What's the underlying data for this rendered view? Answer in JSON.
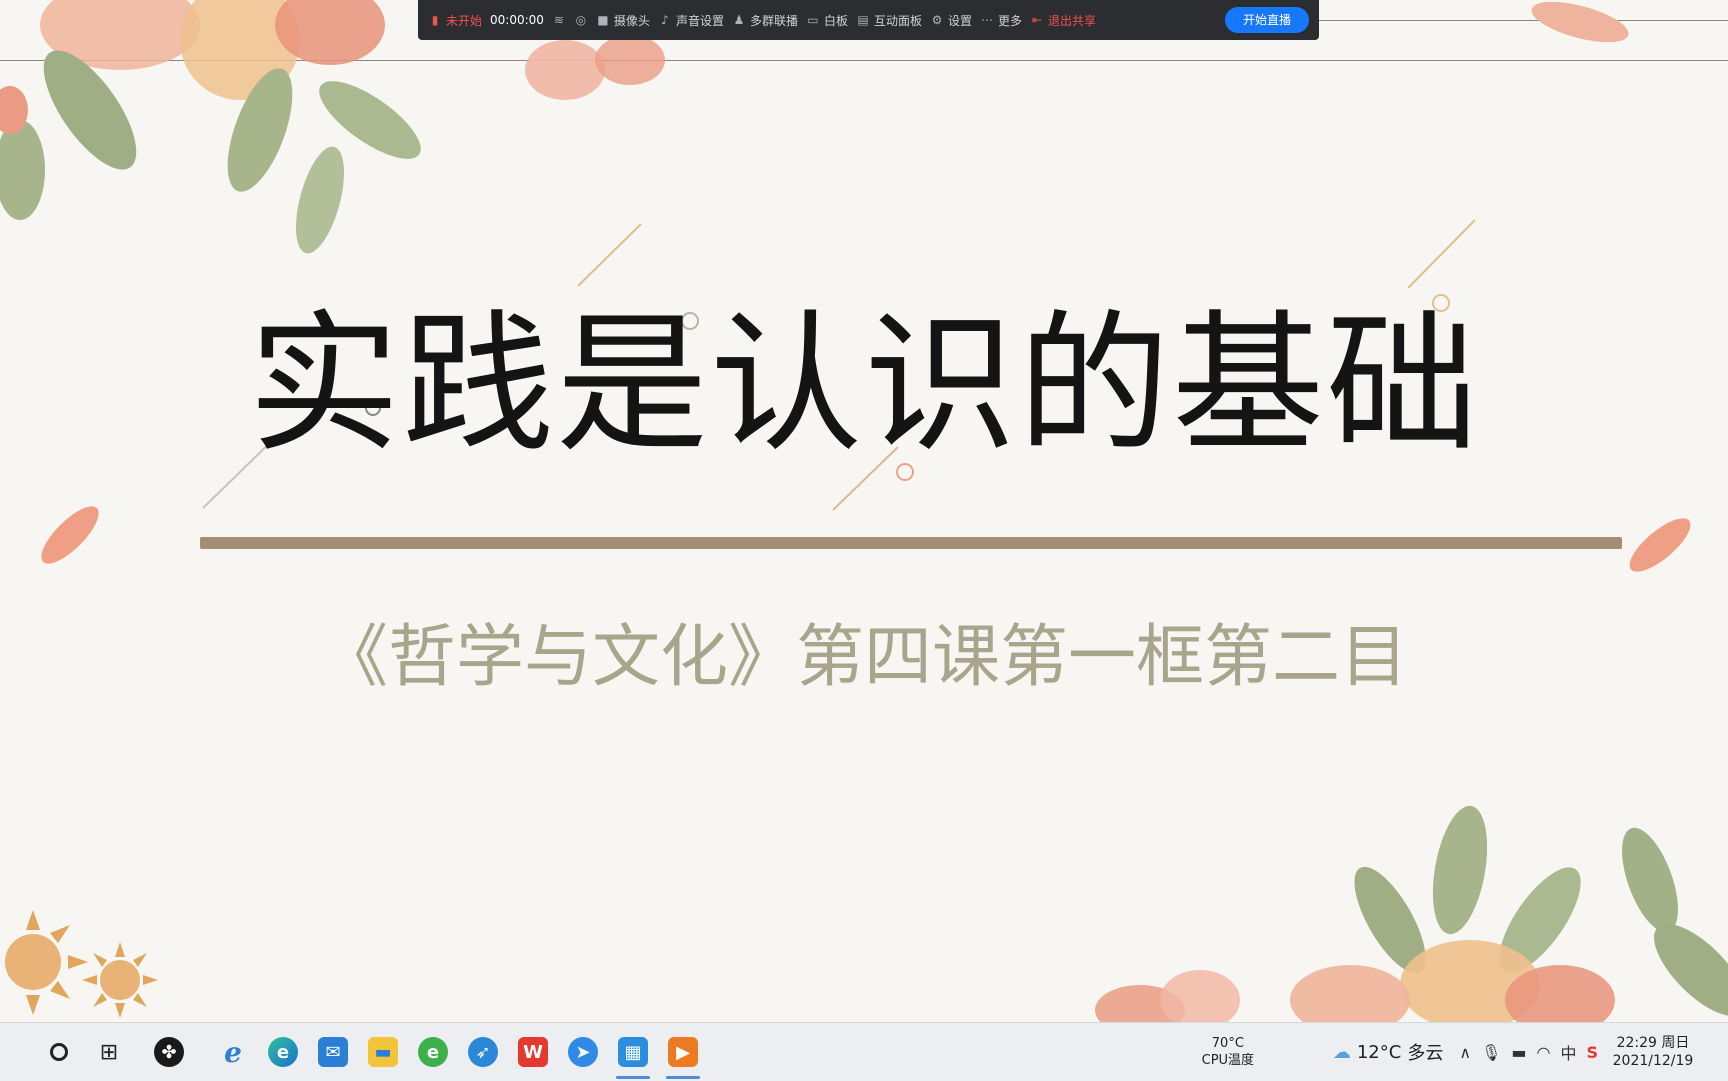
{
  "toolbar": {
    "status_label": "未开始",
    "timer": "00:00:00",
    "items": [
      {
        "label": "摄像头"
      },
      {
        "label": "声音设置"
      },
      {
        "label": "多群联播"
      },
      {
        "label": "白板"
      },
      {
        "label": "互动面板"
      },
      {
        "label": "设置"
      },
      {
        "label": "更多"
      }
    ],
    "exit_label": "退出共享",
    "start_label": "开始直播"
  },
  "slide": {
    "title": "实践是认识的基础",
    "subtitle": "《哲学与文化》第四课第一框第二目",
    "colors": {
      "title": "#141414",
      "bar": "#a48d73",
      "subtitle": "#a9a58c",
      "background": "#f8f6f2"
    }
  },
  "taskbar": {
    "apps": [
      {
        "icon": "search-circle-icon"
      },
      {
        "icon": "task-view-icon"
      },
      {
        "icon": "pinwheel-app-icon"
      },
      {
        "icon": "ie-browser-icon"
      },
      {
        "icon": "edge-browser-icon"
      },
      {
        "icon": "mail-icon"
      },
      {
        "icon": "file-explorer-icon"
      },
      {
        "icon": "green-browser-icon"
      },
      {
        "icon": "blue-bird-app-icon"
      },
      {
        "icon": "wps-icon"
      },
      {
        "icon": "feishu-icon"
      },
      {
        "icon": "calendar-app-icon"
      },
      {
        "icon": "slides-app-icon"
      }
    ],
    "cpu_temp": "70°C",
    "cpu_label": "CPU温度",
    "weather_temp": "12°C",
    "weather_text": "多云",
    "ime": "中",
    "time": "22:29 周日",
    "date": "2021/12/19"
  }
}
